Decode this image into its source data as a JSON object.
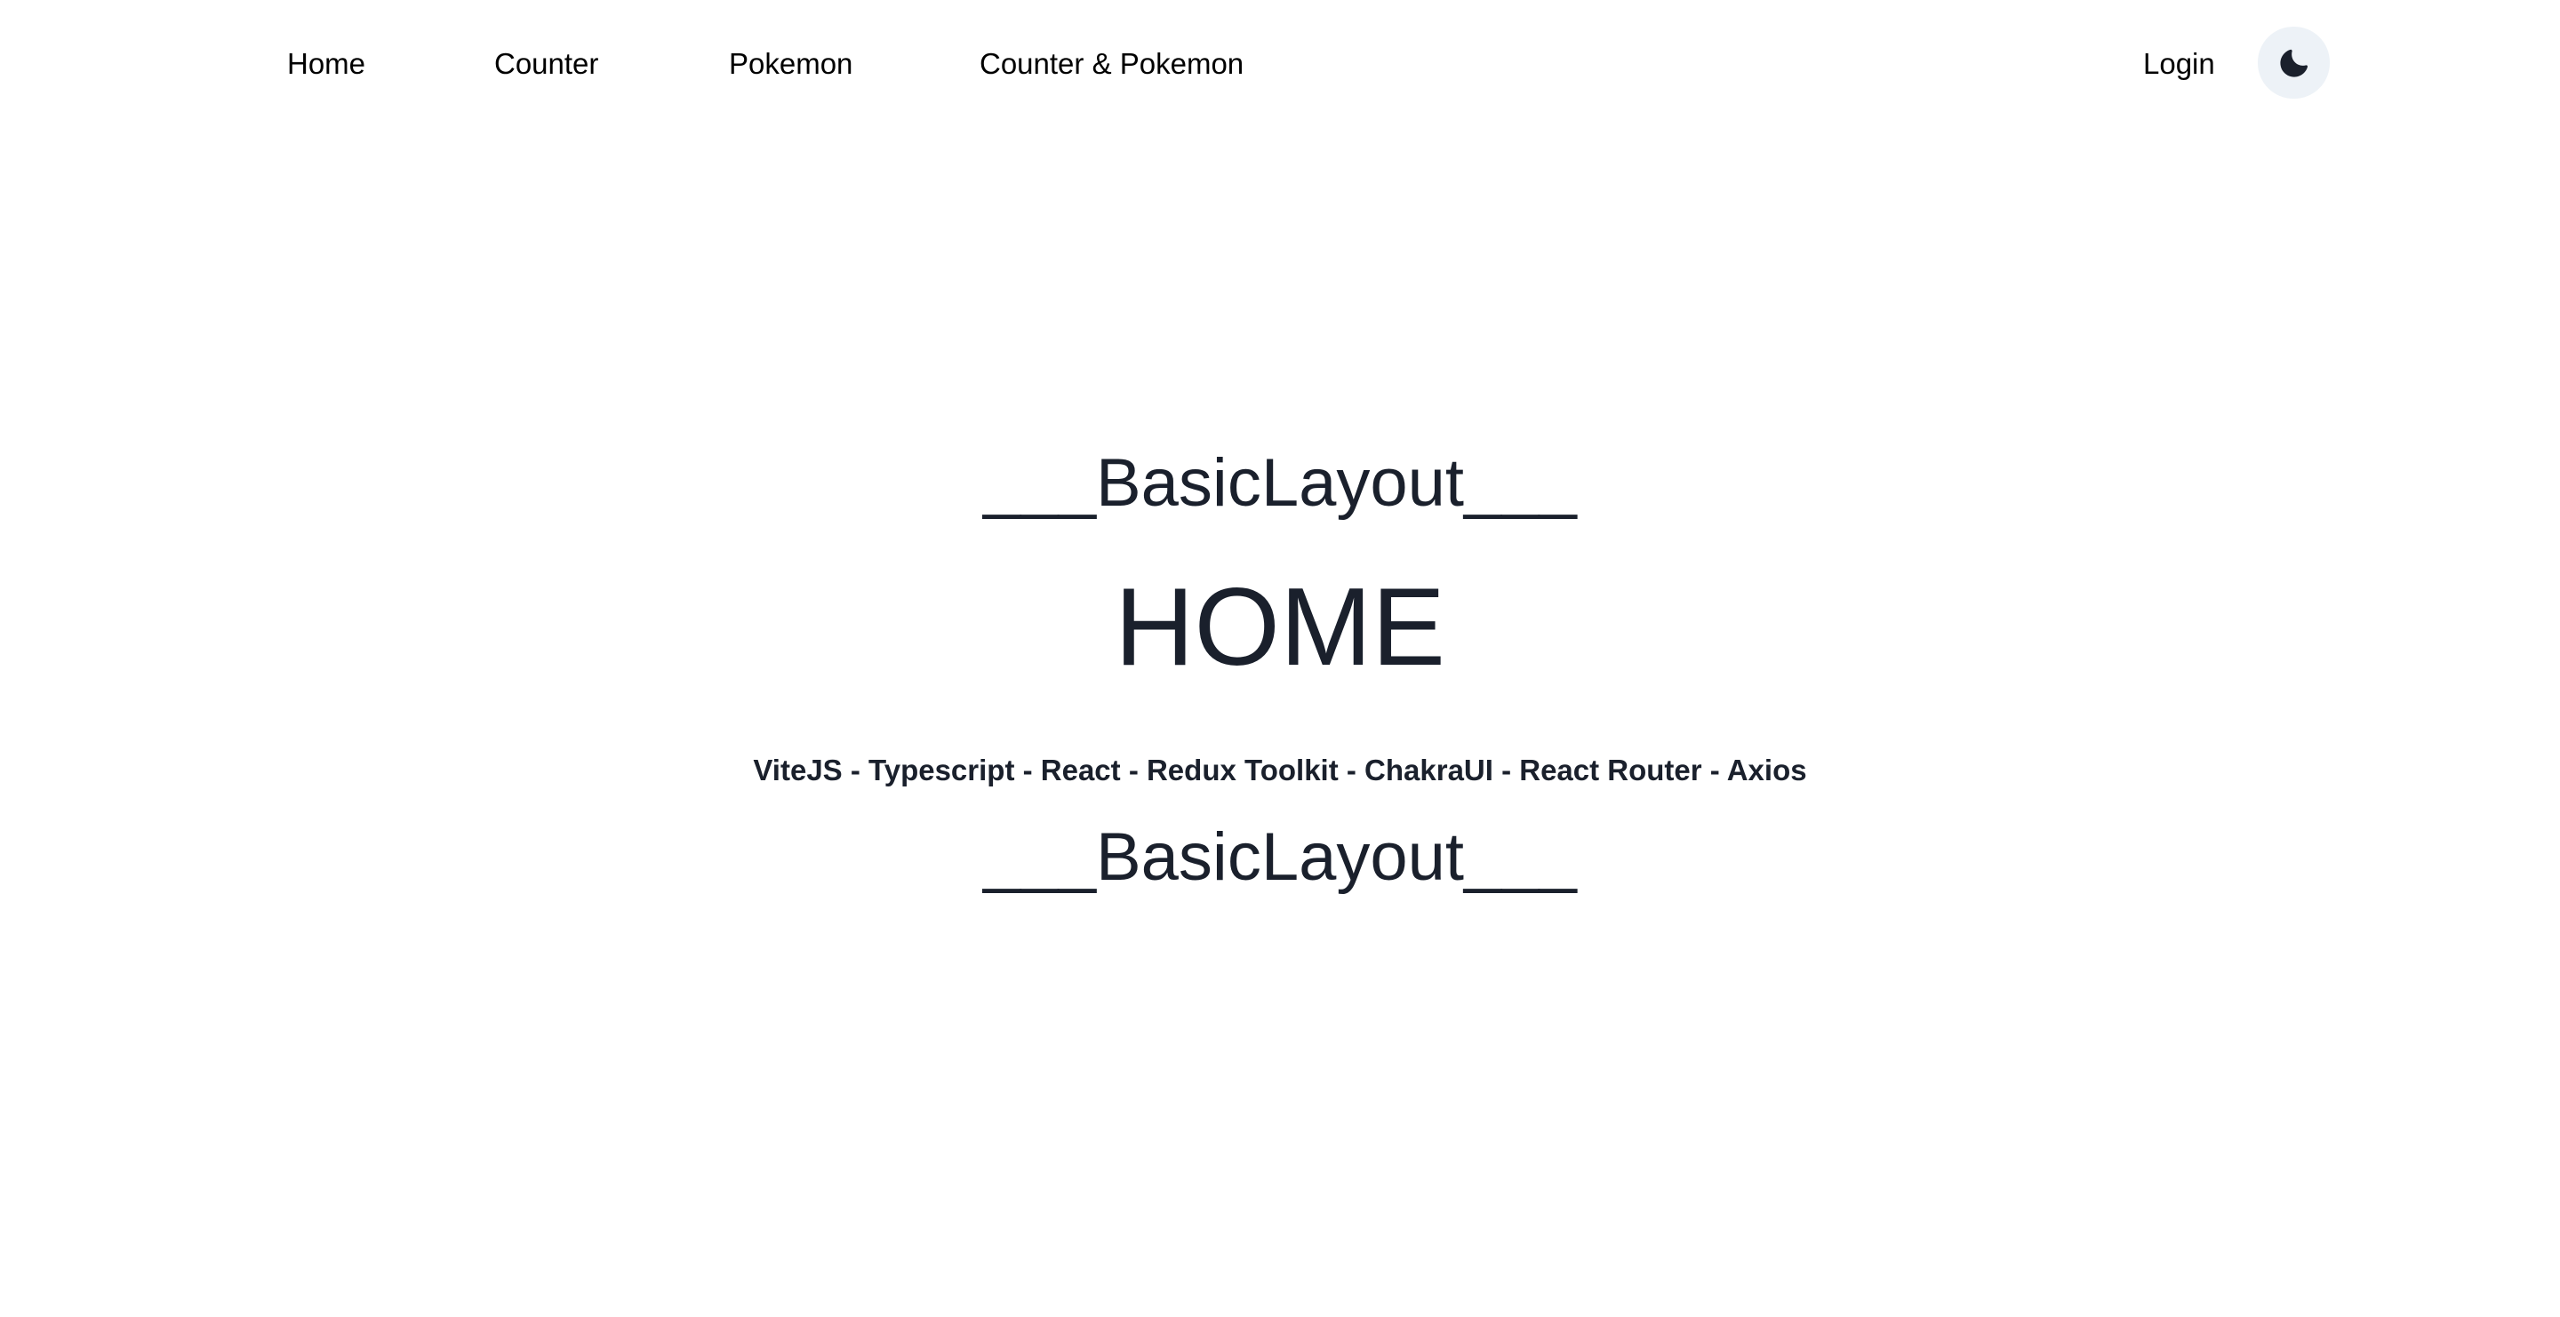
{
  "nav": {
    "links": {
      "home": "Home",
      "counter": "Counter",
      "pokemon": "Pokemon",
      "counter_pokemon": "Counter & Pokemon"
    },
    "login": "Login",
    "theme_toggle_icon": "moon-icon"
  },
  "main": {
    "layout_label_top": "___BasicLayout___",
    "title": "HOME",
    "subtitle": "ViteJS - Typescript - React - Redux Toolkit - ChakraUI - React Router - Axios",
    "layout_label_bottom": "___BasicLayout___"
  },
  "colors": {
    "background": "#ffffff",
    "text": "#1a202c",
    "toggle_background": "#edf2f7"
  }
}
